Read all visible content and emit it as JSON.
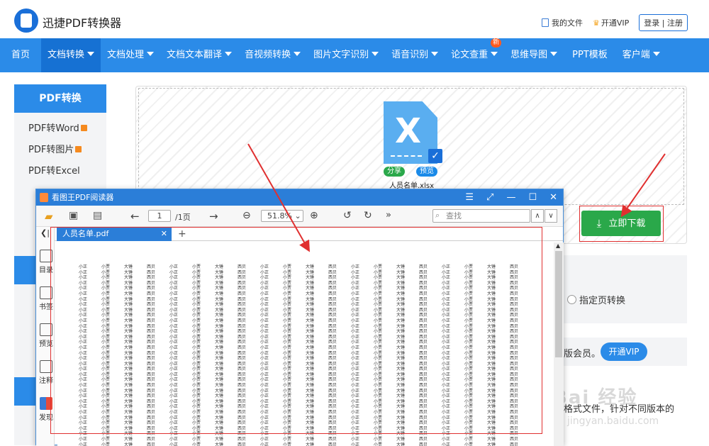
{
  "app": {
    "name": "迅捷PDF转换器"
  },
  "header": {
    "my_files": "我的文件",
    "open_vip": "开通VIP",
    "login": "登录 | 注册"
  },
  "nav": {
    "items": [
      {
        "label": "首页"
      },
      {
        "label": "文档转换"
      },
      {
        "label": "文档处理"
      },
      {
        "label": "文档文本翻译"
      },
      {
        "label": "音视频转换"
      },
      {
        "label": "图片文字识别"
      },
      {
        "label": "语音识别"
      },
      {
        "label": "论文查重"
      },
      {
        "label": "思维导图"
      },
      {
        "label": "PPT模板"
      },
      {
        "label": "客户端"
      }
    ],
    "badge_new": "新"
  },
  "sidebar": {
    "title": "PDF转换",
    "items": [
      {
        "label": "PDF转Word"
      },
      {
        "label": "PDF转图片"
      },
      {
        "label": "PDF转Excel"
      }
    ]
  },
  "upload": {
    "file_name": "人员名单.xlsx",
    "share": "分享",
    "preview": "预览",
    "download": "立即下载"
  },
  "options": {
    "radio_label": "指定页转换",
    "vip_text": "版会员。",
    "vip_button": "开通VIP",
    "bottom_text": "格式文件，针对不同版本的"
  },
  "watermark": {
    "main": "Bai 经验",
    "sub": "jingyan.baidu.com"
  },
  "reader": {
    "title": "看图王PDF阅读器",
    "page": "1",
    "page_total": "/1页",
    "zoom": "51.8%",
    "search_placeholder": "查找",
    "tab": "人员名单.pdf",
    "side_tools": [
      {
        "label": "目录"
      },
      {
        "label": "书签"
      },
      {
        "label": "预览"
      },
      {
        "label": "注释"
      },
      {
        "label": "发现"
      }
    ],
    "names": [
      "小正",
      "小贾",
      "大锤",
      "西贝"
    ]
  },
  "colors": {
    "brand": "#2b8be8",
    "green": "#2aa84a",
    "highlight": "#e03030"
  }
}
